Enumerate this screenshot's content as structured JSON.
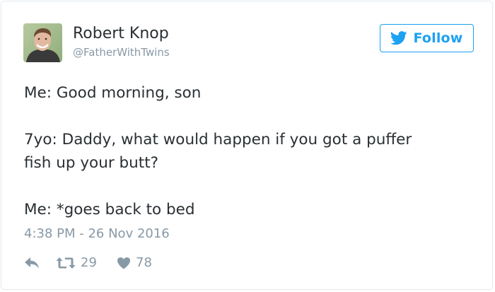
{
  "author": {
    "name": "Robert Knop",
    "handle": "@FatherWithTwins",
    "avatar_icon": "person-avatar"
  },
  "follow_button": {
    "label": "Follow",
    "icon": "bird-icon",
    "color": "#1da1f2"
  },
  "tweet": {
    "lines": [
      "Me: Good morning, son",
      "7yo: Daddy, what would happen if you got a puffer",
      "fish up your butt?",
      "Me: *goes back to bed"
    ]
  },
  "timestamp": "4:38 PM - 26 Nov 2016",
  "actions": {
    "reply_icon": "reply-icon",
    "retweet_icon": "retweet-icon",
    "retweet_count": "29",
    "like_icon": "heart-icon",
    "like_count": "78"
  },
  "colors": {
    "text": "#292f33",
    "muted": "#8899a6",
    "border": "#e1e8ed"
  }
}
